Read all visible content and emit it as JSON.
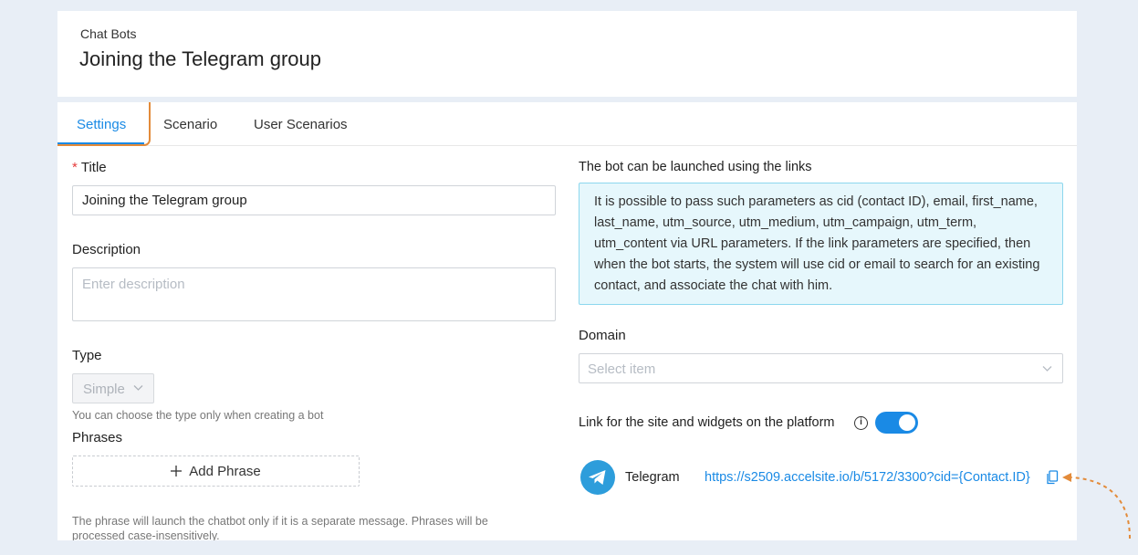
{
  "header": {
    "breadcrumb": "Chat Bots",
    "title": "Joining the Telegram group"
  },
  "tabs": [
    {
      "label": "Settings",
      "active": true
    },
    {
      "label": "Scenario",
      "active": false
    },
    {
      "label": "User Scenarios",
      "active": false
    }
  ],
  "form": {
    "title_label": "Title",
    "title_value": "Joining the Telegram group",
    "description_label": "Description",
    "description_placeholder": "Enter description",
    "type_label": "Type",
    "type_value": "Simple",
    "type_hint": "You can choose the type only when creating a bot",
    "phrases_label": "Phrases",
    "add_phrase_label": "Add Phrase",
    "phrase_hint": "The phrase will launch the chatbot only if it is a separate message. Phrases will be processed case-insensitively."
  },
  "links": {
    "heading": "The bot can be launched using the links",
    "info_text": "It is possible to pass such parameters as cid (contact ID), email, first_name, last_name, utm_source, utm_medium, utm_campaign, utm_term, utm_content via URL parameters. If the link parameters are specified, then when the bot starts, the system will use cid or email to search for an existing contact, and associate the chat with him.",
    "domain_label": "Domain",
    "domain_placeholder": "Select item",
    "platform_link_label": "Link for the site and widgets on the platform",
    "platform_link_enabled": true,
    "telegram_label": "Telegram",
    "telegram_url": "https://s2509.accelsite.io/b/5172/3300?cid={Contact.ID}"
  },
  "colors": {
    "accent": "#1a8ae5",
    "highlight": "#e38b3a",
    "telegram": "#2d9ddb"
  }
}
